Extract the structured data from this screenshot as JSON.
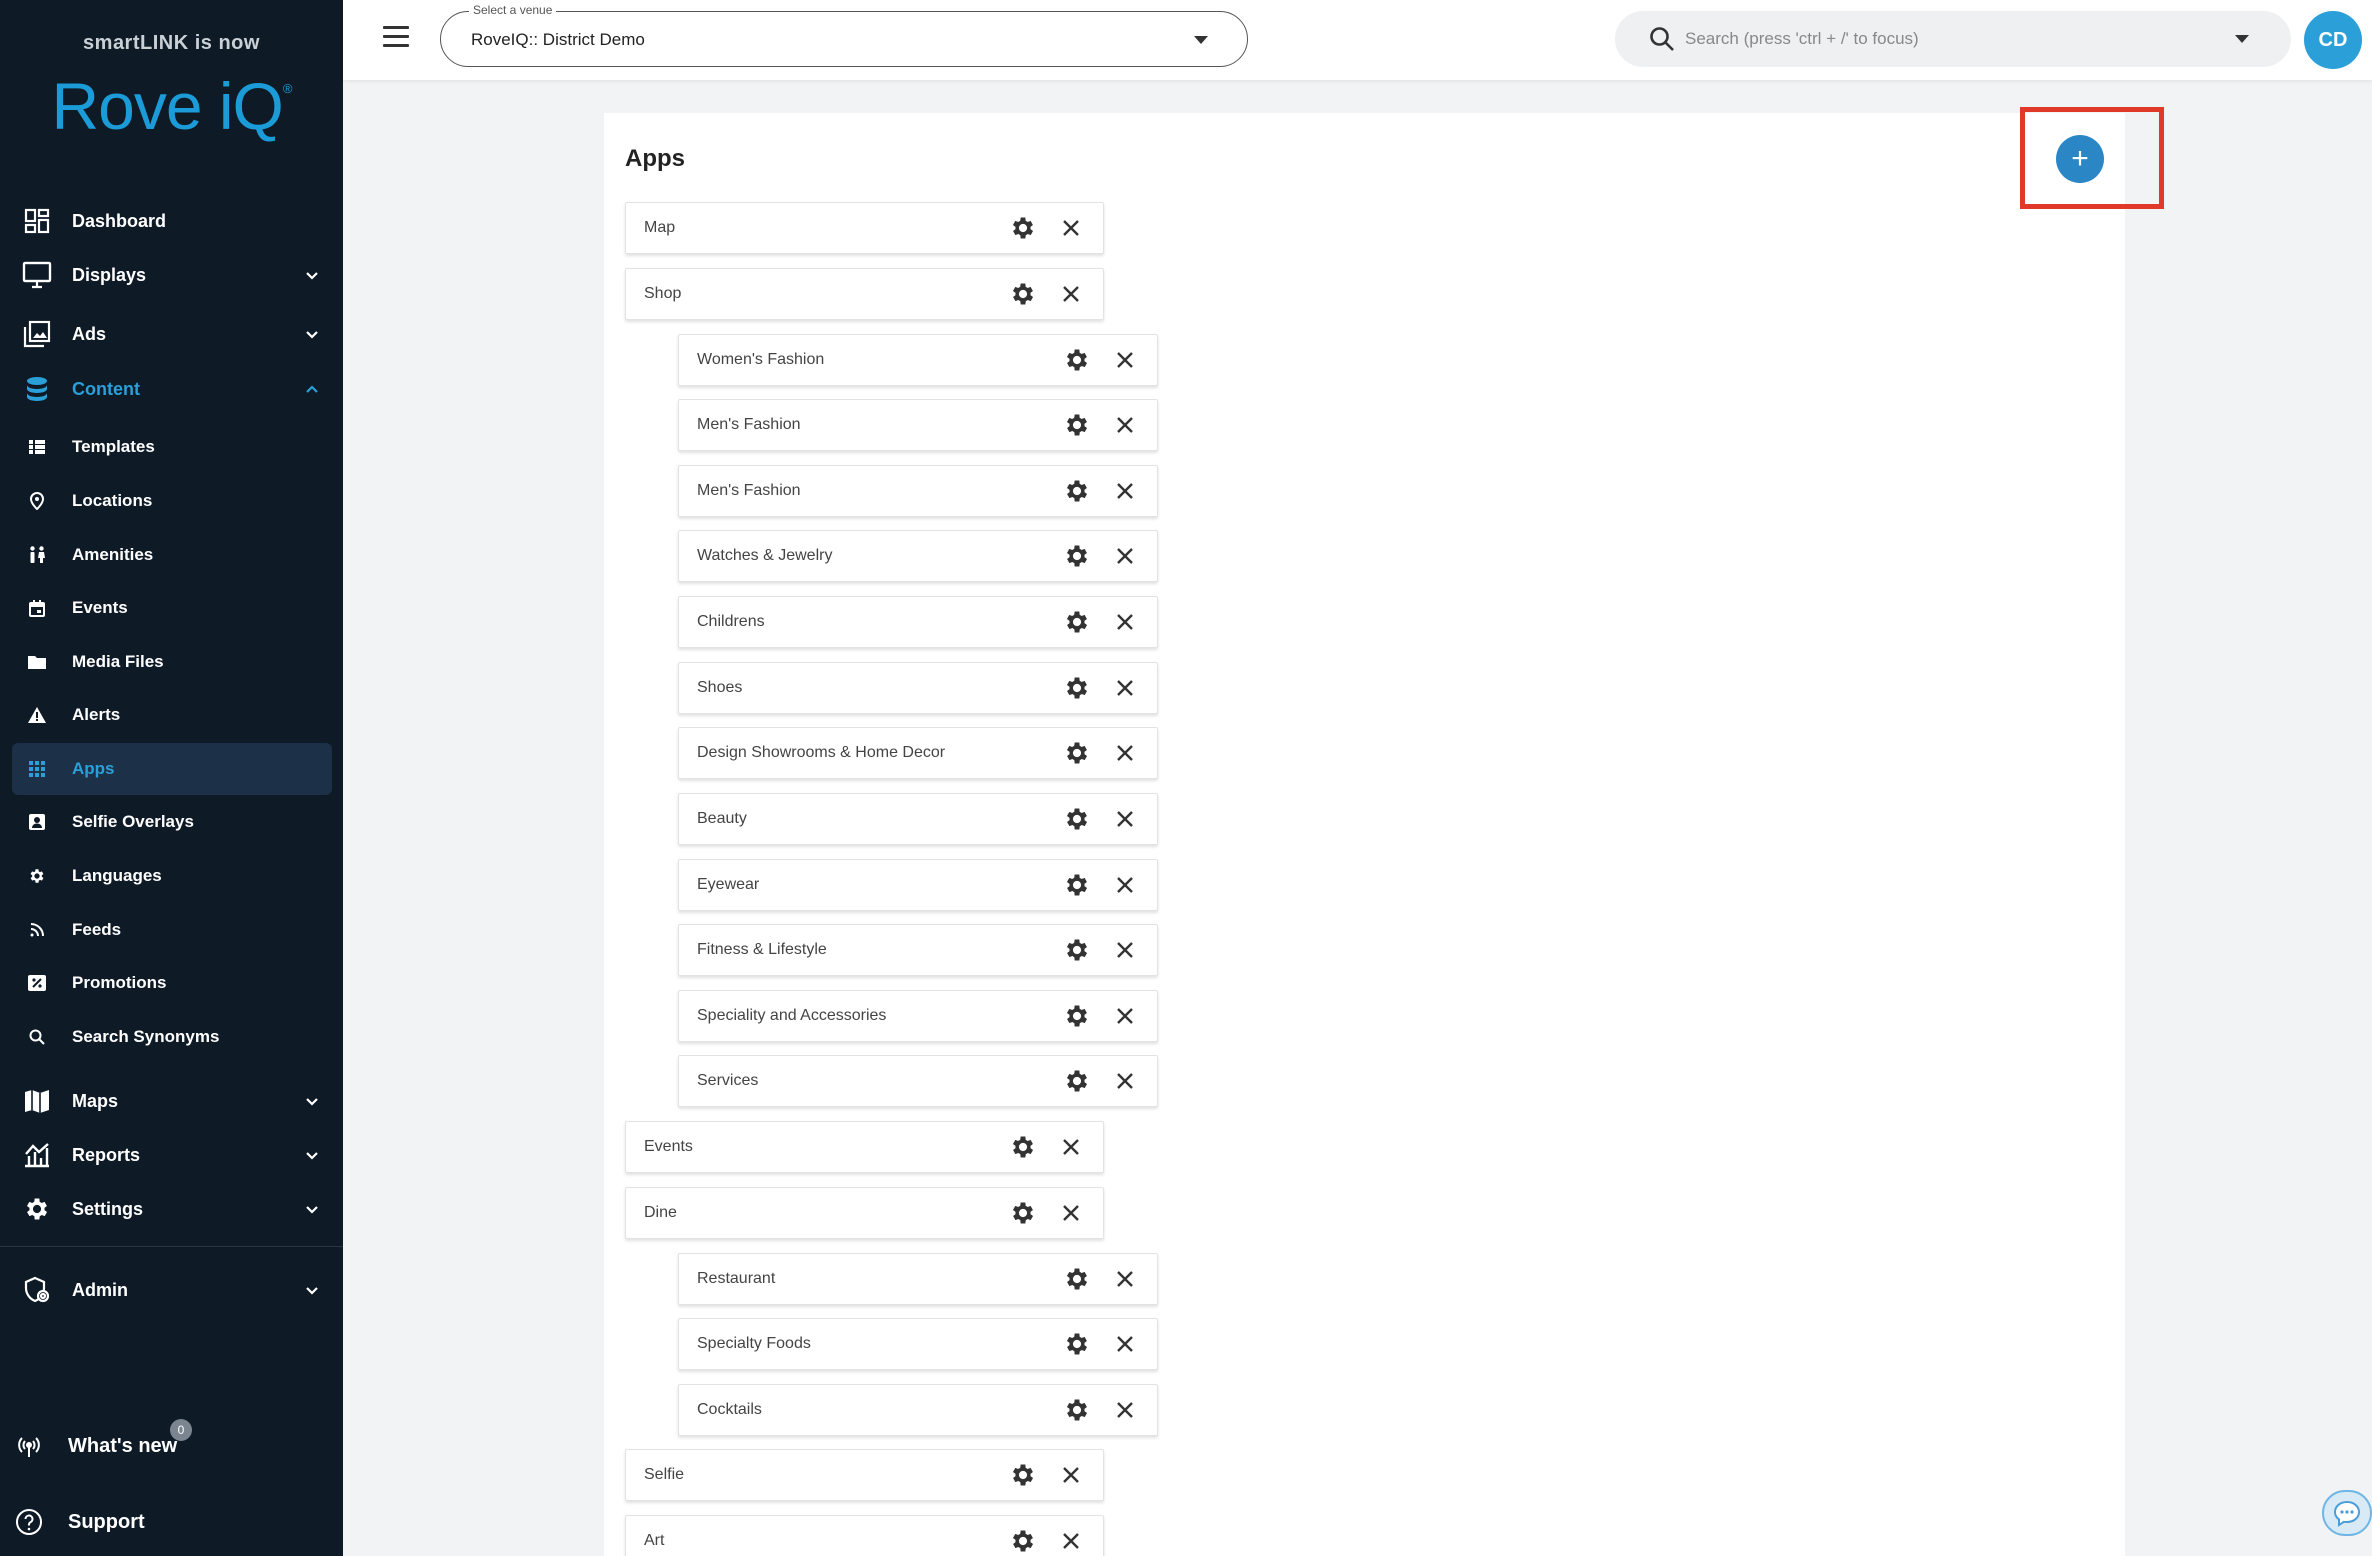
{
  "brand": {
    "tagline": "smartLINK is now",
    "name": "Rove iQ",
    "mark": "®"
  },
  "nav": {
    "dashboard": "Dashboard",
    "displays": "Displays",
    "ads": "Ads",
    "content": "Content",
    "templates": "Templates",
    "locations": "Locations",
    "amenities": "Amenities",
    "events": "Events",
    "media_files": "Media Files",
    "alerts": "Alerts",
    "apps": "Apps",
    "selfie_overlays": "Selfie Overlays",
    "languages": "Languages",
    "feeds": "Feeds",
    "promotions": "Promotions",
    "search_synonyms": "Search Synonyms",
    "maps": "Maps",
    "reports": "Reports",
    "settings": "Settings",
    "admin": "Admin",
    "whats_new": "What's new",
    "whats_new_count": "0",
    "support": "Support"
  },
  "header": {
    "venue_legend": "Select a venue",
    "venue_value": "RoveIQ:: District Demo",
    "search_placeholder": "Search (press 'ctrl + /' to focus)",
    "avatar_initials": "CD"
  },
  "page": {
    "title": "Apps",
    "add_label": "+"
  },
  "apps": {
    "map": "Map",
    "shop": "Shop",
    "womens_fashion": "Women's Fashion",
    "mens_fashion_1": "Men's Fashion",
    "mens_fashion_2": "Men's Fashion",
    "watches_jewelry": "Watches & Jewelry",
    "childrens": "Childrens",
    "shoes": "Shoes",
    "design_showrooms": "Design Showrooms & Home Decor",
    "beauty": "Beauty",
    "eyewear": "Eyewear",
    "fitness": "Fitness & Lifestyle",
    "speciality": "Speciality and Accessories",
    "services": "Services",
    "events": "Events",
    "dine": "Dine",
    "restaurant": "Restaurant",
    "specialty_foods": "Specialty Foods",
    "cocktails": "Cocktails",
    "selfie": "Selfie",
    "art": "Art"
  },
  "colors": {
    "sidebar_bg": "#0e1a26",
    "accent": "#2a9fd8",
    "add_button": "#2a86c4",
    "highlight": "#e0392a"
  }
}
